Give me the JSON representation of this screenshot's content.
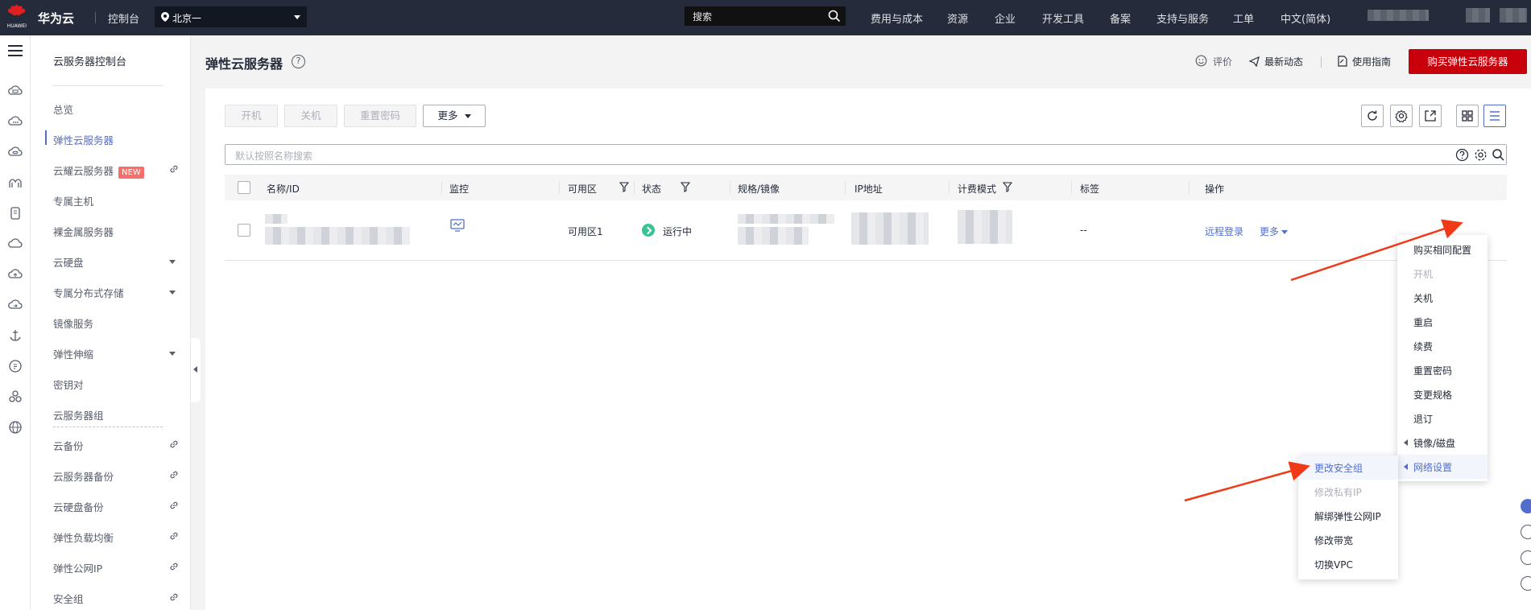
{
  "topbar": {
    "logo_caption": "HUAWEI",
    "brand": "华为云",
    "console": "控制台",
    "region": "北京一",
    "search_placeholder": "搜索",
    "nav": [
      "费用与成本",
      "资源",
      "企业",
      "开发工具",
      "备案",
      "支持与服务",
      "工单",
      "中文(简体)"
    ]
  },
  "rail": {
    "icons": [
      "cloud-server-icon",
      "chat-cloud-icon",
      "cloud-db-icon",
      "bridge-icon",
      "phone-icon",
      "cloud-icon",
      "cloud-upload-icon",
      "cloud-sync-icon",
      "anchor-icon",
      "compass-icon",
      "cluster-icon",
      "globe-icon"
    ]
  },
  "subnav": {
    "title": "云服务器控制台",
    "items": [
      {
        "label": "总览"
      },
      {
        "label": "弹性云服务器",
        "active": true
      },
      {
        "label": "云耀云服务器",
        "badge": "NEW",
        "link": true
      },
      {
        "label": "专属主机"
      },
      {
        "label": "裸金属服务器"
      },
      {
        "label": "云硬盘",
        "caret": true
      },
      {
        "label": "专属分布式存储",
        "caret": true
      },
      {
        "label": "镜像服务"
      },
      {
        "label": "弹性伸缩",
        "caret": true
      },
      {
        "label": "密钥对"
      },
      {
        "label": "云服务器组"
      },
      {
        "label": "云备份",
        "link": true
      },
      {
        "label": "云服务器备份",
        "link": true
      },
      {
        "label": "云硬盘备份",
        "link": true
      },
      {
        "label": "弹性负载均衡",
        "link": true
      },
      {
        "label": "弹性公网IP",
        "link": true
      },
      {
        "label": "安全组",
        "link": true
      }
    ]
  },
  "header": {
    "title": "弹性云服务器",
    "help": "?",
    "rate": "评价",
    "news": "最新动态",
    "guide": "使用指南",
    "buy": "购买弹性云服务器"
  },
  "toolbar": {
    "start": "开机",
    "stop": "关机",
    "reset_pwd": "重置密码",
    "more": "更多"
  },
  "search": {
    "placeholder": "默认按照名称搜索"
  },
  "table": {
    "columns": [
      "名称/ID",
      "监控",
      "可用区",
      "状态",
      "规格/镜像",
      "IP地址",
      "计费模式",
      "标签",
      "操作"
    ],
    "row": {
      "zone": "可用区1",
      "status": "运行中",
      "tag": "--",
      "remote_login": "远程登录",
      "more": "更多"
    }
  },
  "more_menu": [
    {
      "label": "购买相同配置"
    },
    {
      "label": "开机",
      "disabled": true
    },
    {
      "label": "关机"
    },
    {
      "label": "重启"
    },
    {
      "label": "续费"
    },
    {
      "label": "重置密码"
    },
    {
      "label": "变更规格"
    },
    {
      "label": "退订"
    },
    {
      "label": "镜像/磁盘",
      "submenu": true
    },
    {
      "label": "网络设置",
      "submenu": true,
      "hover": true
    }
  ],
  "network_submenu": [
    {
      "label": "更改安全组",
      "hover": true
    },
    {
      "label": "修改私有IP",
      "disabled": true
    },
    {
      "label": "解绑弹性公网IP"
    },
    {
      "label": "修改带宽"
    },
    {
      "label": "切换VPC"
    }
  ],
  "colors": {
    "brand_red": "#c7000b",
    "accent_blue": "#526ecc",
    "topbar": "#252b3a",
    "status_green": "#3ac295",
    "annotation_arrow": "#f03a17"
  }
}
